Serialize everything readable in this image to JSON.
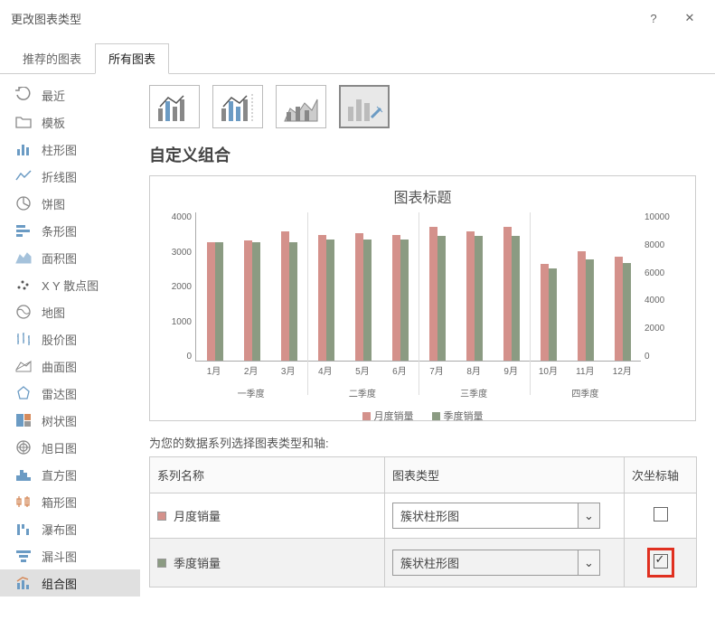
{
  "window": {
    "title": "更改图表类型"
  },
  "tabs": {
    "recommended": "推荐的图表",
    "all": "所有图表"
  },
  "sidebar": {
    "items": [
      {
        "label": "最近"
      },
      {
        "label": "模板"
      },
      {
        "label": "柱形图"
      },
      {
        "label": "折线图"
      },
      {
        "label": "饼图"
      },
      {
        "label": "条形图"
      },
      {
        "label": "面积图"
      },
      {
        "label": "X Y 散点图"
      },
      {
        "label": "地图"
      },
      {
        "label": "股价图"
      },
      {
        "label": "曲面图"
      },
      {
        "label": "雷达图"
      },
      {
        "label": "树状图"
      },
      {
        "label": "旭日图"
      },
      {
        "label": "直方图"
      },
      {
        "label": "箱形图"
      },
      {
        "label": "瀑布图"
      },
      {
        "label": "漏斗图"
      },
      {
        "label": "组合图"
      }
    ]
  },
  "content": {
    "section_title": "自定义组合",
    "chart_preview_title": "图表标题",
    "legend": {
      "monthly": "月度销量",
      "quarterly": "季度销量"
    },
    "instruction": "为您的数据系列选择图表类型和轴:",
    "table": {
      "col_series": "系列名称",
      "col_type": "图表类型",
      "col_secondary": "次坐标轴",
      "rows": [
        {
          "name": "月度销量",
          "color": "#d4918b",
          "type": "簇状柱形图",
          "secondary": false
        },
        {
          "name": "季度销量",
          "color": "#8b9b82",
          "type": "簇状柱形图",
          "secondary": true
        }
      ]
    }
  },
  "chart_data": {
    "type": "bar",
    "title": "图表标题",
    "categories_months": [
      "1月",
      "2月",
      "3月",
      "4月",
      "5月",
      "6月",
      "7月",
      "8月",
      "9月",
      "10月",
      "11月",
      "12月"
    ],
    "categories_quarters": [
      "一季度",
      "二季度",
      "三季度",
      "四季度"
    ],
    "series": [
      {
        "name": "月度销量",
        "axis": "left",
        "color": "#d4918b",
        "values": [
          3200,
          3250,
          3500,
          3400,
          3450,
          3400,
          3600,
          3500,
          3600,
          2600,
          2950,
          2800
        ]
      },
      {
        "name": "季度销量",
        "axis": "right",
        "color": "#8b9b82",
        "values": [
          8000,
          8000,
          8000,
          8200,
          8200,
          8200,
          8400,
          8400,
          8400,
          6200,
          6800,
          6600
        ]
      }
    ],
    "y_left": {
      "min": 0,
      "max": 4000,
      "ticks": [
        0,
        1000,
        2000,
        3000,
        4000
      ],
      "label": ""
    },
    "y_right": {
      "min": 0,
      "max": 10000,
      "ticks": [
        0,
        2000,
        4000,
        6000,
        8000,
        10000
      ],
      "label": ""
    }
  }
}
